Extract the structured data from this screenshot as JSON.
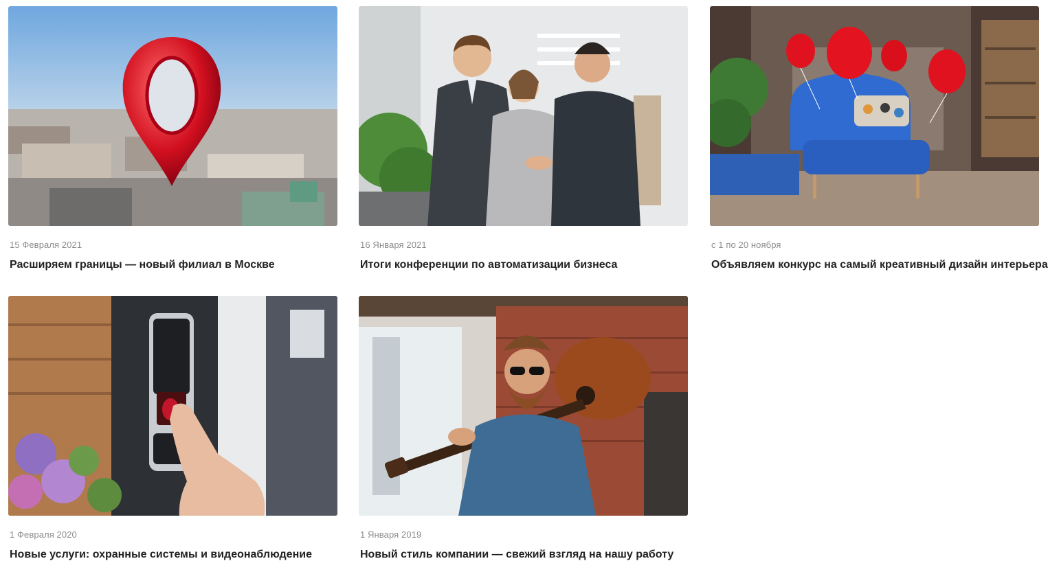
{
  "news": {
    "items": [
      {
        "date": "15 Февраля 2021",
        "title": "Расширяем границы — новый филиал в Москве",
        "image": "moscow-location-pin-image"
      },
      {
        "date": "16 Января 2021",
        "title": "Итоги конференции по автоматизации бизнеса",
        "image": "business-handshake-image"
      },
      {
        "date": "с 1 по 20 ноября",
        "title": "Объявляем конкурс на самый креативный дизайн интерьера",
        "image": "blue-armchair-balloons-image"
      },
      {
        "date": "1 Февраля 2020",
        "title": "Новые услуги: охранные системы и видеонаблюдение",
        "image": "fingerprint-scanner-image"
      },
      {
        "date": "1 Января 2019",
        "title": "Новый стиль компании — свежий взгляд на нашу работу",
        "image": "bearded-man-guitar-image"
      }
    ]
  },
  "colors": {
    "title": "#222222",
    "date": "#8c8c8c",
    "background": "#ffffff"
  }
}
